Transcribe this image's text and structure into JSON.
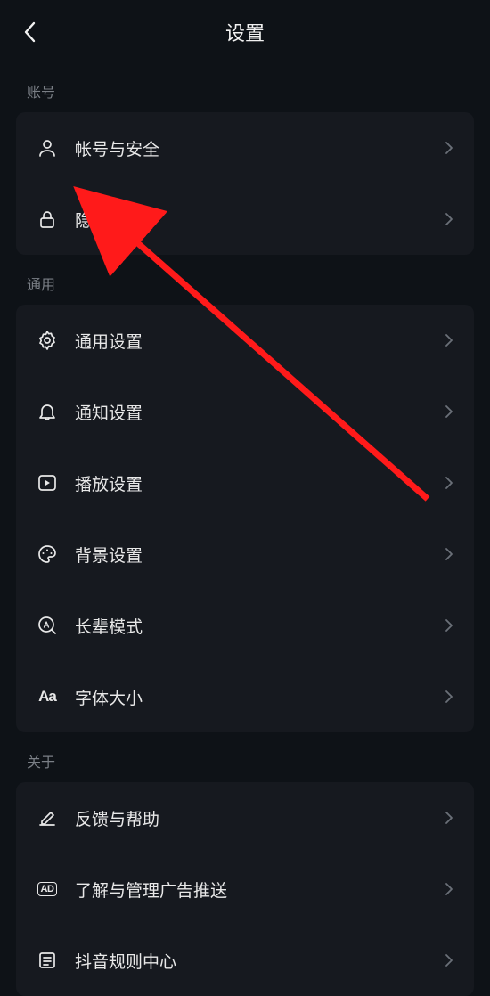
{
  "header": {
    "title": "设置"
  },
  "sections": {
    "account": {
      "label": "账号",
      "items": [
        {
          "label": "帐号与安全"
        },
        {
          "label": "隐私设置"
        }
      ]
    },
    "general": {
      "label": "通用",
      "items": [
        {
          "label": "通用设置"
        },
        {
          "label": "通知设置"
        },
        {
          "label": "播放设置"
        },
        {
          "label": "背景设置"
        },
        {
          "label": "长辈模式"
        },
        {
          "label": "字体大小"
        }
      ]
    },
    "about": {
      "label": "关于",
      "items": [
        {
          "label": "反馈与帮助"
        },
        {
          "label": "了解与管理广告推送"
        },
        {
          "label": "抖音规则中心"
        }
      ]
    }
  },
  "annotation": {
    "arrow_color": "#ff1a1a"
  }
}
